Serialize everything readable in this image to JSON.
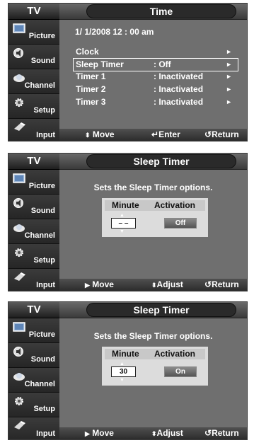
{
  "sidebar": {
    "header": "TV",
    "items": [
      {
        "label": "Picture",
        "icon": "picture-icon"
      },
      {
        "label": "Sound",
        "icon": "sound-icon"
      },
      {
        "label": "Channel",
        "icon": "channel-icon"
      },
      {
        "label": "Setup",
        "icon": "setup-icon"
      },
      {
        "label": "Input",
        "icon": "input-icon"
      }
    ]
  },
  "screen1": {
    "title": "Time",
    "date": "1/  1/2008  12 : 00 am",
    "rows": [
      {
        "key": "Clock",
        "value": ""
      },
      {
        "key": "Sleep Timer",
        "value": ": Off"
      },
      {
        "key": "Timer 1",
        "value": ": Inactivated"
      },
      {
        "key": "Timer 2",
        "value": ": Inactivated"
      },
      {
        "key": "Timer 3",
        "value": ": Inactivated"
      }
    ],
    "arrow": "►",
    "footer": {
      "move": "Move",
      "enter": "Enter",
      "return": "Return"
    }
  },
  "screen2": {
    "title": "Sleep Timer",
    "hint": "Sets the Sleep Timer options.",
    "col_minute": "Minute",
    "col_activation": "Activation",
    "minute_value": "– –",
    "activation_value": "Off",
    "footer": {
      "move": "Move",
      "adjust": "Adjust",
      "return": "Return"
    }
  },
  "screen3": {
    "title": "Sleep Timer",
    "hint": "Sets the Sleep Timer options.",
    "col_minute": "Minute",
    "col_activation": "Activation",
    "minute_value": "30",
    "activation_value": "On",
    "footer": {
      "move": "Move",
      "adjust": "Adjust",
      "return": "Return"
    }
  }
}
